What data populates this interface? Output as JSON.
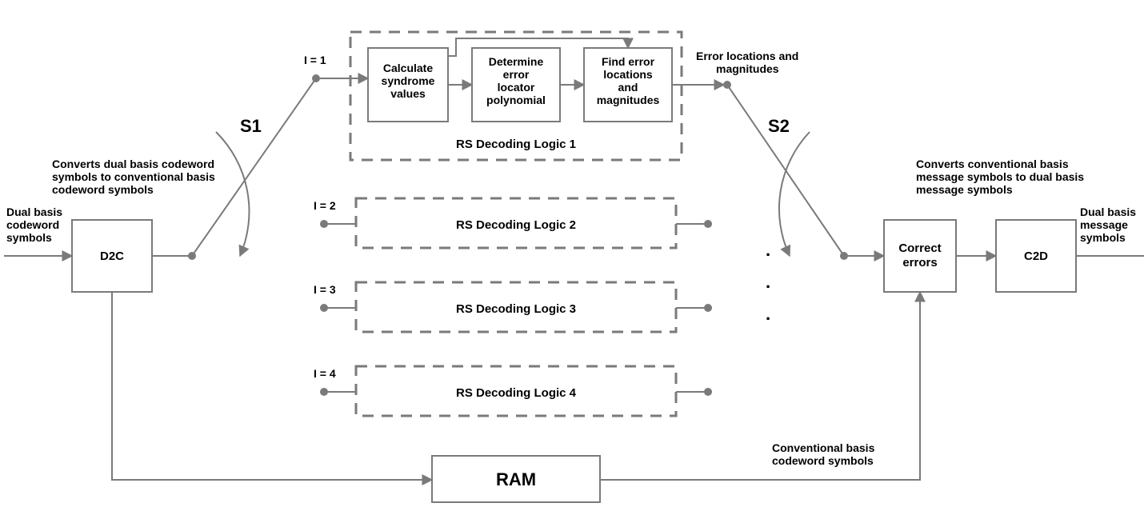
{
  "input_label_l1": "Dual basis",
  "input_label_l2": "codeword",
  "input_label_l3": "symbols",
  "d2c": {
    "title": "D2C",
    "desc_l1": "Converts dual basis codeword",
    "desc_l2": "symbols to conventional basis",
    "desc_l3": "codeword symbols"
  },
  "switch1": "S1",
  "switch2": "S2",
  "idx1": "I = 1",
  "idx2": "I = 2",
  "idx3": "I = 3",
  "idx4": "I = 4",
  "logic1": {
    "title": "RS Decoding Logic 1",
    "step1_l1": "Calculate",
    "step1_l2": "syndrome",
    "step1_l3": "values",
    "step2_l1": "Determine",
    "step2_l2": "error",
    "step2_l3": "locator",
    "step2_l4": "polynomial",
    "step3_l1": "Find error",
    "step3_l2": "locations",
    "step3_l3": "and",
    "step3_l4": "magnitudes"
  },
  "logic2_title": "RS Decoding Logic 2",
  "logic3_title": "RS Decoding Logic 3",
  "logic4_title": "RS Decoding Logic 4",
  "err_label_l1": "Error locations and",
  "err_label_l2": "magnitudes",
  "correct_box": "Correct errors",
  "correct_box_l1": "Correct",
  "correct_box_l2": "errors",
  "c2d": {
    "title": "C2D",
    "desc_l1": "Converts conventional basis",
    "desc_l2": "message symbols to dual basis",
    "desc_l3": "message symbols"
  },
  "output_label_l1": "Dual basis",
  "output_label_l2": "message",
  "output_label_l3": "symbols",
  "ram": "RAM",
  "ram_label_l1": "Conventional basis",
  "ram_label_l2": "codeword symbols",
  "dots": "."
}
